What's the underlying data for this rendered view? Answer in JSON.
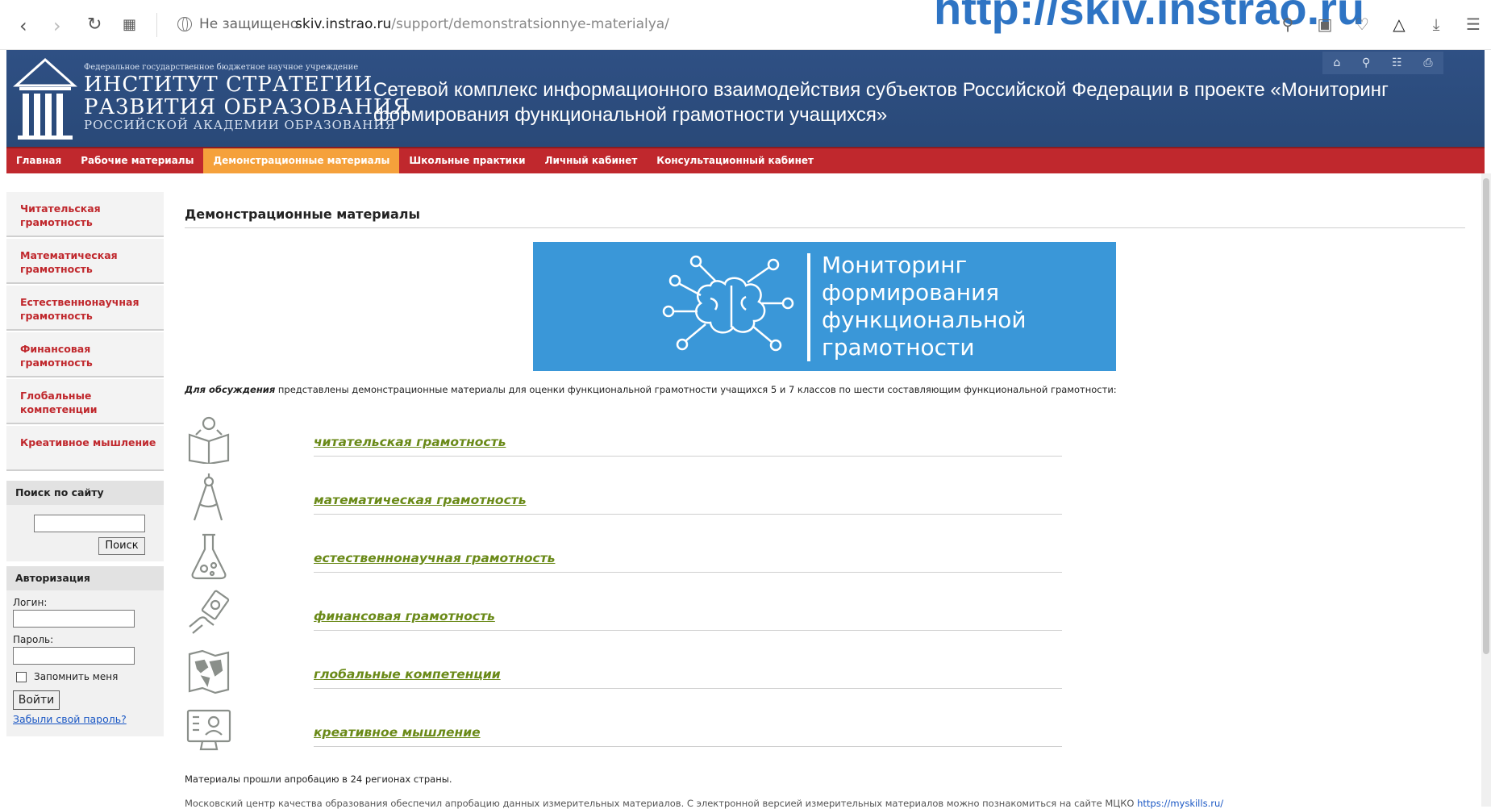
{
  "browser": {
    "security_label": "Не защищено",
    "url_domain": "skiv.instrao.ru",
    "url_path": "/support/demonstratsionnye-materialya/",
    "overlay_url": "http://skiv.instrao.ru"
  },
  "header": {
    "logo_small": "Федеральное государственное бюджетное научное учреждение",
    "logo_line1": "ИНСТИТУТ СТРАТЕГИИ",
    "logo_line2": "РАЗВИТИЯ ОБРАЗОВАНИЯ",
    "logo_line3": "РОССИЙСКОЙ АКАДЕМИИ ОБРАЗОВАНИЯ",
    "title": "Сетевой комплекс информационного взаимодействия субъектов Российской Федерации в проекте «Мониторинг формирования функциональной грамотности учащихся»"
  },
  "nav": [
    "Главная",
    "Рабочие материалы",
    "Демонстрационные материалы",
    "Школьные практики",
    "Личный кабинет",
    "Консультационный кабинет"
  ],
  "sidebar": {
    "items": [
      "Читательская грамотность",
      "Математическая грамотность",
      "Естественнонаучная грамотность",
      "Финансовая грамотность",
      "Глобальные компетенции",
      "Креативное мышление"
    ],
    "search_title": "Поиск по сайту",
    "search_button": "Поиск",
    "auth_title": "Авторизация",
    "login_label": "Логин:",
    "password_label": "Пароль:",
    "remember_label": "Запомнить меня",
    "login_button": "Войти",
    "forgot_link": "Забыли свой пароль?"
  },
  "content": {
    "page_title": "Демонстрационные материалы",
    "banner_line1": "Мониторинг",
    "banner_line2": "формирования",
    "banner_line3": "функциональной",
    "banner_line4": "грамотности",
    "intro_bold": "Для обсуждения",
    "intro_rest": " представлены демонстрационные материалы для оценки функциональной грамотности учащихся 5 и 7 классов по шести составляющим функциональной грамотности:",
    "competencies": [
      {
        "label": "читательская грамотность",
        "icon": "book-reader-icon"
      },
      {
        "label": "математическая грамотность",
        "icon": "compass-icon"
      },
      {
        "label": "естественнонаучная грамотность",
        "icon": "flask-icon"
      },
      {
        "label": "финансовая грамотность",
        "icon": "money-hand-icon"
      },
      {
        "label": "глобальные компетенции",
        "icon": "world-map-icon"
      },
      {
        "label": "креативное мышление",
        "icon": "monitor-user-icon"
      }
    ],
    "footer_note": "Материалы прошли апробацию в 24 регионах страны.",
    "footer_note2": "Московский центр качества образования обеспечил апробацию данных измерительных материалов. С электронной версией измерительных материалов можно познакомиться на сайте МЦКО ",
    "footer_link": "https://myskills.ru/"
  },
  "colors": {
    "header_blue": "#2f5084",
    "nav_red": "#c0282d",
    "nav_active": "#f5a13b",
    "link_green": "#6a8a18",
    "banner_blue": "#3a97d8"
  }
}
